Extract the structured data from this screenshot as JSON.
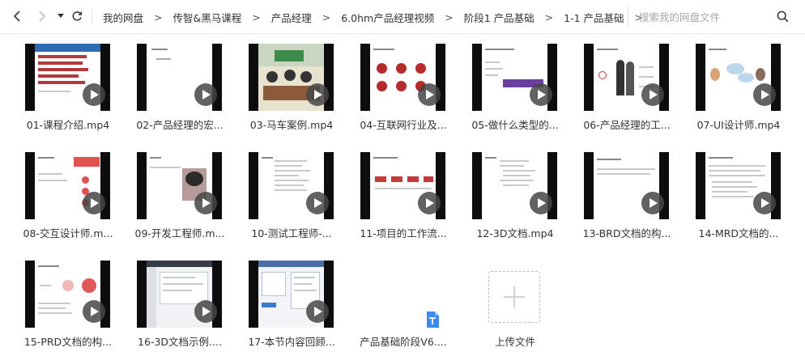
{
  "toolbar": {
    "breadcrumb": [
      "我的网盘",
      "传智&黑马课程",
      "产品经理",
      "6.0hm产品经理视频",
      "阶段1 产品基础",
      "1-1 产品基础"
    ],
    "search_placeholder": "搜索我的网盘文件"
  },
  "files": [
    {
      "name": "01-课程介绍.mp4",
      "type": "video"
    },
    {
      "name": "02-产品经理的宏...",
      "type": "video"
    },
    {
      "name": "03-马车案例.mp4",
      "type": "video"
    },
    {
      "name": "04-互联网行业及...",
      "type": "video"
    },
    {
      "name": "05-做什么类型的...",
      "type": "video"
    },
    {
      "name": "06-产品经理的工...",
      "type": "video"
    },
    {
      "name": "07-UI设计师.mp4",
      "type": "video"
    },
    {
      "name": "08-交互设计师.m...",
      "type": "video"
    },
    {
      "name": "09-开发工程师.m...",
      "type": "video"
    },
    {
      "name": "10-测试工程师-...",
      "type": "video"
    },
    {
      "name": "11-项目的工作流...",
      "type": "video"
    },
    {
      "name": "12-3D文档.mp4",
      "type": "video"
    },
    {
      "name": "13-BRD文档的构...",
      "type": "video"
    },
    {
      "name": "14-MRD文档的...",
      "type": "video"
    },
    {
      "name": "15-PRD文档的构...",
      "type": "video"
    },
    {
      "name": "16-3D文档示例....",
      "type": "video"
    },
    {
      "name": "17-本节内容回顾...",
      "type": "video"
    },
    {
      "name": "产品基础阶段V6....",
      "type": "document"
    }
  ],
  "upload": {
    "label": "上传文件"
  }
}
